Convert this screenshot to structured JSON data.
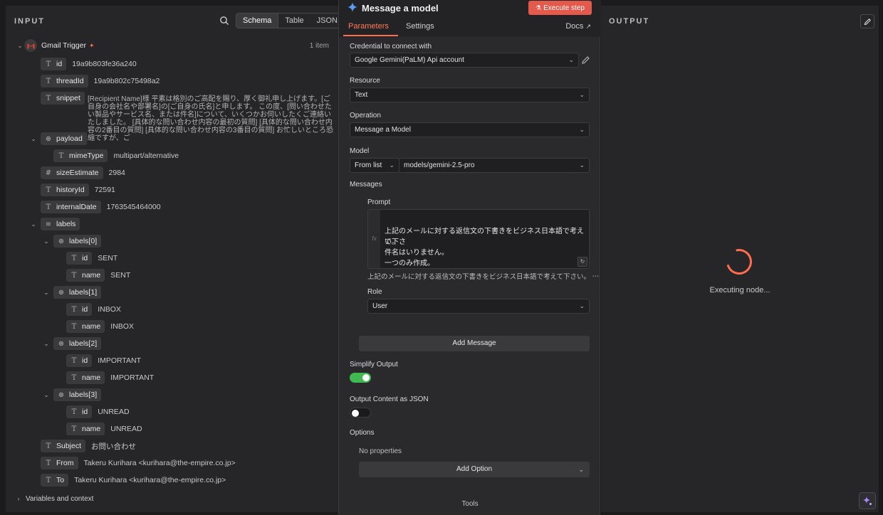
{
  "input": {
    "title": "INPUT",
    "views": [
      "Schema",
      "Table",
      "JSON"
    ],
    "trigger_name": "Gmail Trigger",
    "item_count": "1 item",
    "fields": {
      "id": {
        "key": "id",
        "value": "19a9b803fe36a240"
      },
      "threadId": {
        "key": "threadId",
        "value": "19a9b802c75498a2"
      },
      "snippet": {
        "key": "snippet",
        "value": "[Recipient Name]様 平素は格別のご高配を賜り、厚く御礼申し上げます。[ご自身の会社名や部署名]の[ご自身の氏名]と申します。 この度、[問い合わせたい製品やサービス名、または件名]について、いくつかお伺いしたくご連絡いたしました。 [具体的な問い合わせ内容の最初の質問] [具体的な問い合わせ内容の2番目の質問] [具体的な問い合わせ内容の3番目の質問] お忙しいところ恐縮ですが、ご"
      },
      "payload": {
        "key": "payload"
      },
      "mimeType": {
        "key": "mimeType",
        "value": "multipart/alternative"
      },
      "sizeEstimate": {
        "key": "sizeEstimate",
        "value": "2984"
      },
      "historyId": {
        "key": "historyId",
        "value": "72591"
      },
      "internalDate": {
        "key": "internalDate",
        "value": "1763545464000"
      },
      "labels": {
        "key": "labels"
      },
      "labels_items": [
        {
          "key": "labels[0]",
          "id_key": "id",
          "id": "SENT",
          "name_key": "name",
          "name": "SENT"
        },
        {
          "key": "labels[1]",
          "id_key": "id",
          "id": "INBOX",
          "name_key": "name",
          "name": "INBOX"
        },
        {
          "key": "labels[2]",
          "id_key": "id",
          "id": "IMPORTANT",
          "name_key": "name",
          "name": "IMPORTANT"
        },
        {
          "key": "labels[3]",
          "id_key": "id",
          "id": "UNREAD",
          "name_key": "name",
          "name": "UNREAD"
        }
      ],
      "Subject": {
        "key": "Subject",
        "value": "お問い合わせ"
      },
      "From": {
        "key": "From",
        "value": "Takeru Kurihara <kurihara@the-empire.co.jp>"
      },
      "To": {
        "key": "To",
        "value": "Takeru Kurihara <kurihara@the-empire.co.jp>"
      }
    },
    "variables_label": "Variables and context"
  },
  "node": {
    "title": "Message a model",
    "execute_label": "Execute step",
    "tabs": {
      "parameters": "Parameters",
      "settings": "Settings",
      "docs": "Docs"
    },
    "credential_label": "Credential to connect with",
    "credential_value": "Google Gemini(PaLM) Api account",
    "resource_label": "Resource",
    "resource_value": "Text",
    "operation_label": "Operation",
    "operation_value": "Message a Model",
    "model_label": "Model",
    "model_mode": "From list",
    "model_value": "models/gemini-2.5-pro",
    "messages_label": "Messages",
    "prompt_label": "Prompt",
    "prompt_gutter": "fx",
    "prompt_lines": [
      "上記のメールに対する返信文の下書きをビジネス日本語で考えて下さ",
      "い。",
      "件名はいりません。",
      "一つのみ作成。"
    ],
    "prompt_preview": "上記のメールに対する返信文の下書きをビジネス日本語で考えて下さい。 ⋯",
    "role_label": "Role",
    "role_value": "User",
    "add_message_label": "Add Message",
    "simplify_label": "Simplify Output",
    "simplify_on": true,
    "json_label": "Output Content as JSON",
    "json_on": false,
    "options_label": "Options",
    "no_props": "No properties",
    "add_option_label": "Add Option",
    "tools_label": "Tools"
  },
  "output": {
    "title": "OUTPUT",
    "status": "Executing node..."
  },
  "colors": {
    "accent": "#ff6d4d",
    "toggle_on": "#3fb950",
    "toggle_off": "#1a1a1c"
  }
}
